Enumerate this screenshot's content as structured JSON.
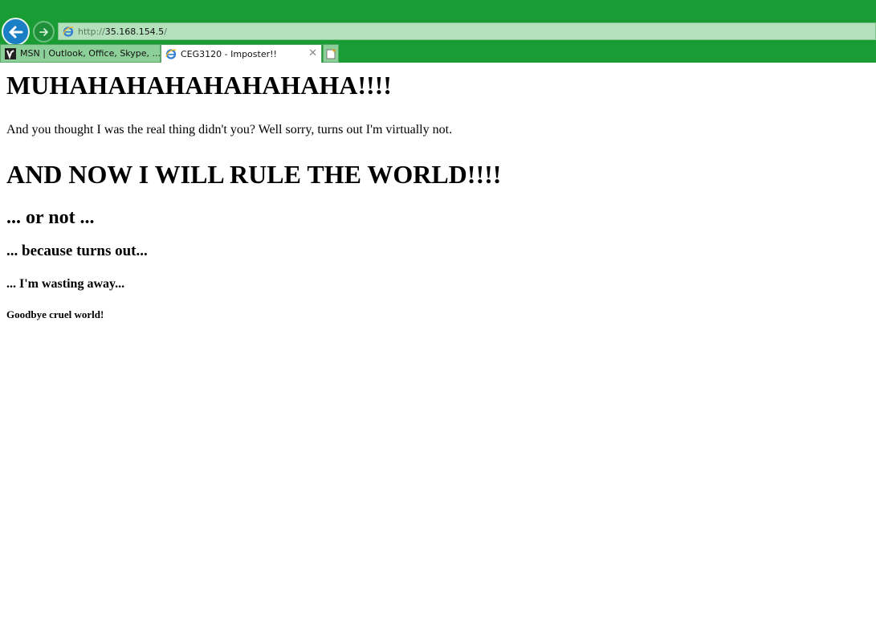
{
  "browser": {
    "url_scheme": "http://",
    "url_host": "35.168.154.5",
    "url_trail": "/",
    "tabs": [
      {
        "label": "MSN | Outlook, Office, Skype, ..."
      },
      {
        "label": "CEG3120 - Imposter!!"
      }
    ],
    "colors": {
      "chrome": "#1a9c35",
      "back_button": "#1a7fc4"
    }
  },
  "content": {
    "heading_1": "MUHAHAHAHAHAHAHAHA!!!!",
    "paragraph": "And you thought I was the real thing didn't you? Well sorry, turns out I'm virtually not.",
    "heading_2": "AND NOW I WILL RULE THE WORLD!!!!",
    "heading_3": "... or not ...",
    "heading_4": "... because turns out...",
    "heading_5": "... I'm wasting away...",
    "heading_6": "Goodbye cruel world!"
  }
}
